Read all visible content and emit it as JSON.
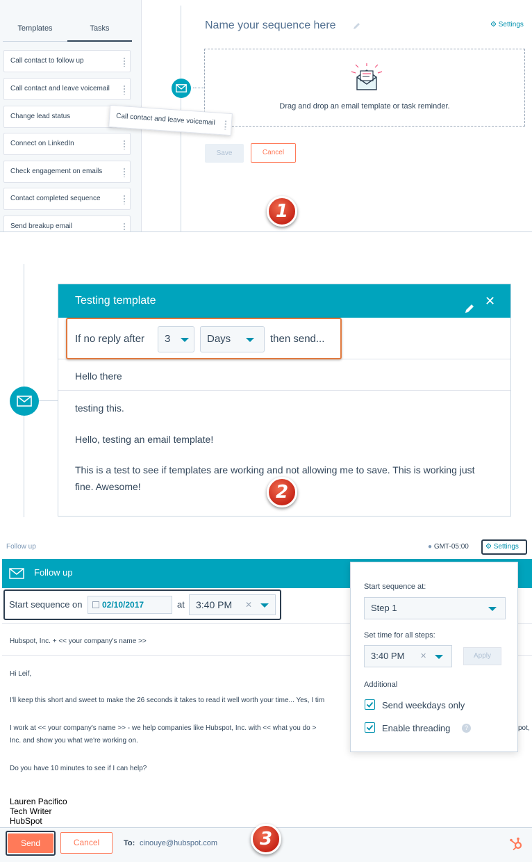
{
  "panel1": {
    "tabs": [
      "Templates",
      "Tasks"
    ],
    "tasks": [
      "Call contact to follow up",
      "Call contact and leave voicemail",
      "Change lead status",
      "Connect on LinkedIn",
      "Check engagement on emails",
      "Contact completed sequence",
      "Send breakup email"
    ],
    "dragging_item": "Call contact and leave voicemail",
    "sequence_name": "Name your sequence here",
    "settings_link": "Settings",
    "dropzone_text": "Drag and drop an email template or task reminder.",
    "save_label": "Save",
    "cancel_label": "Cancel",
    "step_badge": "1"
  },
  "panel2": {
    "title": "Testing template",
    "no_reply_prefix": "If no reply after",
    "delay_value": "3",
    "delay_unit": "Days",
    "no_reply_suffix": "then send...",
    "subject": "Hello there",
    "body_line1": "testing this.",
    "body_line2": "Hello, testing an email template!",
    "body_line3a": "This is a test to see if templates are working and not allowing me to save. This is working just",
    "body_line3b": "fine. Awesome!",
    "step_badge": "2"
  },
  "panel3": {
    "breadcrumb": "Follow up",
    "timezone": "GMT-05:00",
    "settings_label": "Settings",
    "header_title": "Follow up",
    "start_label": "Start sequence on",
    "start_date": "02/10/2017",
    "at_label": "at",
    "start_time": "3:40 PM",
    "company_line": "Hubspot, Inc. + << your company's name >>",
    "greeting": "Hi Leif,",
    "para1": "I'll keep this short and sweet to make the 26 seconds it takes to read it well worth your time... Yes, I tim",
    "para2a": "I work at <<  your company's name  >> - we help companies like Hubspot, Inc. with <<  what you do  >",
    "para2_tail": "pot,",
    "para2b": "Inc. and show you what we're working on.",
    "para3": "Do you have 10 minutes to see if I can help?",
    "sig_name": "Lauren Pacifico",
    "sig_title": "Tech Writer",
    "sig_company": "HubSpot",
    "popover": {
      "start_label": "Start sequence at:",
      "start_value": "Step 1",
      "time_label": "Set time for all steps:",
      "time_value": "3:40 PM",
      "apply_label": "Apply",
      "additional_label": "Additional",
      "weekdays_label": "Send weekdays only",
      "threading_label": "Enable threading"
    },
    "send_label": "Send",
    "cancel_label": "Cancel",
    "to_label": "To:",
    "to_email": "cinouye@hubspot.com",
    "step_badge": "3"
  },
  "colors": {
    "teal": "#00a4bd",
    "orange": "#ff7a59",
    "text": "#33475b",
    "dark_outline": "#2d3e50"
  }
}
